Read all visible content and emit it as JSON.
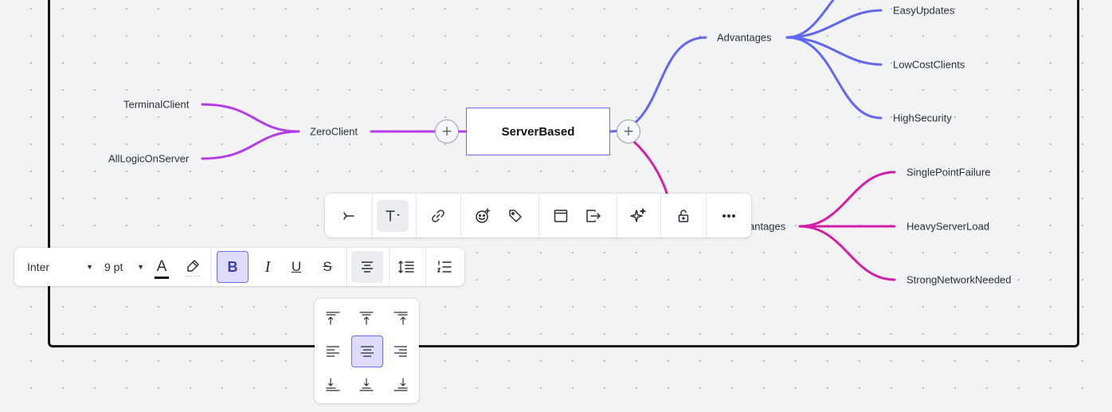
{
  "colors": {
    "accent": "#6b6ef0",
    "branch_blue": "#6366f1",
    "branch_purple": "#b53bea",
    "branch_magenta": "#d11fa8"
  },
  "mindmap": {
    "root": "ServerBased",
    "left_child": "ZeroClient",
    "left_leaves": [
      "TerminalClient",
      "AllLogicOnServer"
    ],
    "advantages": "Advantages",
    "advantage_leaves": [
      "EasyUpdates",
      "LowCostClients",
      "HighSecurity"
    ],
    "disadvantages_visible": "antages",
    "disadvantage_leaves": [
      "SinglePointFailure",
      "HeavyServerLoad",
      "StrongNetworkNeeded"
    ],
    "plus_symbol": "+"
  },
  "toolbar": {
    "icons": [
      "collapse-branch-icon",
      "text-style-icon",
      "link-icon",
      "add-sticker-icon",
      "tag-icon",
      "frame-icon",
      "export-icon",
      "ai-sparkle-icon",
      "lock-icon",
      "more-icon"
    ]
  },
  "format_bar": {
    "font": "Inter",
    "size": "9 pt",
    "text_color_glyph": "A",
    "bold_glyph": "B",
    "italic_glyph": "I",
    "underline_glyph": "U",
    "strike_glyph": "S",
    "active_alignment": "center",
    "text_color": "#111111"
  },
  "align_popover": {
    "rows": [
      "top",
      "middle",
      "bottom"
    ],
    "cols": [
      "left",
      "center",
      "right"
    ],
    "selected": "middle-center"
  }
}
